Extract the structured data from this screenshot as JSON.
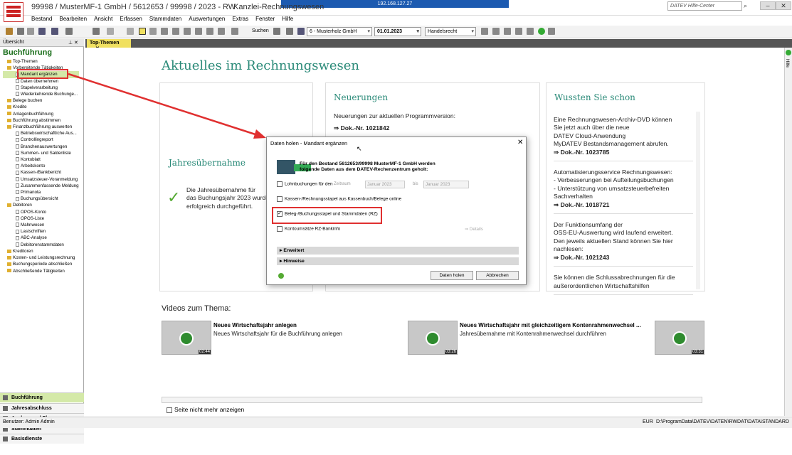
{
  "window": {
    "title": "99998 / MusterMF-1 GmbH / 5612653 / 99998 / 2023 - RW",
    "app_title": "Kanzlei-Rechnungswesen",
    "remote": "192.168.127.27",
    "help_placeholder": "DATEV Hilfe-Center"
  },
  "menu": [
    "Bestand",
    "Bearbeiten",
    "Ansicht",
    "Erfassen",
    "Stammdaten",
    "Auswertungen",
    "Extras",
    "Fenster",
    "Hilfe"
  ],
  "toolbar": {
    "search": "Suchen",
    "client": "6 - Musterholz GmbH",
    "date": "01.01.2023",
    "law": "Handelsrecht"
  },
  "left": {
    "pane_label": "Übersicht",
    "title": "Buchführung",
    "tree": [
      [
        "f",
        "Top-Themen",
        0
      ],
      [
        "f",
        "Vorbereitende Tätigkeiten",
        0
      ],
      [
        "d",
        "Mandant ergänzen",
        1
      ],
      [
        "d",
        "Daten übernehmen",
        1
      ],
      [
        "d",
        "Stapelverarbeitung",
        1
      ],
      [
        "d",
        "Wiederkehrende Buchunge...",
        1
      ],
      [
        "f",
        "Belege buchen",
        0
      ],
      [
        "f",
        "Kredite",
        0
      ],
      [
        "f",
        "Anlagenbuchführung",
        0
      ],
      [
        "f",
        "Buchführung abstimmen",
        0
      ],
      [
        "f",
        "Finanzbuchführung auswerten",
        0
      ],
      [
        "d",
        "Betriebswirtschaftliche Aus...",
        1
      ],
      [
        "d",
        "Controllingreport",
        1
      ],
      [
        "d",
        "Branchenauswertungen",
        1
      ],
      [
        "d",
        "Summen- und Saldenliste",
        1
      ],
      [
        "d",
        "Kontoblatt",
        1
      ],
      [
        "d",
        "Arbeitskonto",
        1
      ],
      [
        "d",
        "Kassen-/Bankbericht",
        1
      ],
      [
        "d",
        "Umsatzsteuer-Voranmeldung",
        1
      ],
      [
        "d",
        "Zusammenfassende Meldung",
        1
      ],
      [
        "d",
        "Primanota",
        1
      ],
      [
        "d",
        "Buchungsübersicht",
        1
      ],
      [
        "f",
        "Debitoren",
        0
      ],
      [
        "d",
        "OPOS-Konto",
        1
      ],
      [
        "d",
        "OPOS-Liste",
        1
      ],
      [
        "d",
        "Mahnwesen",
        1
      ],
      [
        "d",
        "Lastschriften",
        1
      ],
      [
        "d",
        "ABC-Analyse",
        1
      ],
      [
        "d",
        "Debitorenstammdaten",
        1
      ],
      [
        "f",
        "Kreditoren",
        0
      ],
      [
        "f",
        "Kosten- und Leistungsrechnung",
        0
      ],
      [
        "f",
        "Buchungsperiode abschließen",
        0
      ],
      [
        "f",
        "Abschließende Tätigkeiten",
        0
      ]
    ],
    "nav": [
      "Buchführung",
      "Jahresabschluss",
      "Analyse und Planung",
      "Stammdaten",
      "Basisdienste"
    ]
  },
  "tab": "Top-Themen",
  "main": {
    "heading": "Aktuelles im Rechnungswesen",
    "card1": {
      "title": "Jahresübernahme",
      "text1": "Die Jahresübernahme für",
      "text2": "das Buchungsjahr 2023 wurde",
      "text3": "erfolgreich durchgeführt."
    },
    "card2": {
      "title": "Neuerungen",
      "text": "Neuerungen zur aktuellen Programmversion:",
      "doc": "Dok.-Nr. 1021842"
    },
    "card3": {
      "title": "Wussten Sie schon",
      "b1": [
        "Eine Rechnungswesen-Archiv-DVD können",
        "Sie jetzt auch über die neue",
        "DATEV Cloud-Anwendung",
        "MyDATEV Bestandsmanagement abrufen."
      ],
      "d1": "Dok.-Nr. 1023785",
      "b2": [
        "Automatisierungsservice Rechnungswesen:",
        "- Verbesserungen bei Aufteilungsbuchungen",
        "- Unterstützung von umsatzsteuerbefreiten",
        "Sachverhalten"
      ],
      "d2": "Dok.-Nr. 1018721",
      "b3": [
        "Der Funktionsumfang der",
        "OSS-EU-Auswertung wird laufend erweitert.",
        "Den jeweils aktuellen Stand können Sie hier",
        "nachlesen:"
      ],
      "d3": "Dok.-Nr. 1021243",
      "b4": [
        "Sie können die Schlussabrechnungen für die",
        "außerordentlichen Wirtschaftshilfen"
      ]
    },
    "videos_title": "Videos zum Thema:",
    "videos": [
      {
        "title": "Neues Wirtschaftsjahr anlegen",
        "sub": "Neues Wirtschaftsjahr für die Buchführung anlegen",
        "dur": "02:44"
      },
      {
        "title": "Neues Wirtschaftsjahr mit gleichzeitigem Kontenrahmenwechsel ...",
        "sub": "Jahresübernahme mit Kontenrahmenwechsel durchführen",
        "dur": "03:26"
      },
      {
        "title": "",
        "sub": "",
        "dur": "03:31"
      }
    ],
    "no_more": "Seite nicht mehr anzeigen"
  },
  "dialog": {
    "title": "Daten holen - Mandant ergänzen",
    "head1": "Für den Bestand 5612653/99998 MusterMF-1 GmbH werden",
    "head2": "folgende Daten aus dem DATEV-Rechenzentrum geholt:",
    "opt1": "Lohnbuchungen für den",
    "zeitraum": "Zeitraum",
    "von": "Januar 2023",
    "bis_label": "bis",
    "bis": "Januar 2023",
    "opt2": "Kassen-/Rechnungsstapel aus Kassenbuch/Belege online",
    "opt3": "Beleg-/Buchungsstapel und Stammdaten (RZ)",
    "opt4": "Kontoumsätze RZ-Bankinfo",
    "details": "Details",
    "sec1": "Erweitert",
    "sec2": "Hinweise",
    "ok": "Daten holen",
    "cancel": "Abbrechen"
  },
  "status": {
    "user": "Benutzer: Admin Admin",
    "currency": "EUR",
    "path": "D:\\ProgramData\\DATEV\\DATEN\\RWDAT\\DATA\\STANDARD"
  },
  "sidebar_label": "Hilfe",
  "colors": {
    "accent": "#2a8a78",
    "highlight": "#e03030",
    "nav_active": "#d4e9a8"
  }
}
